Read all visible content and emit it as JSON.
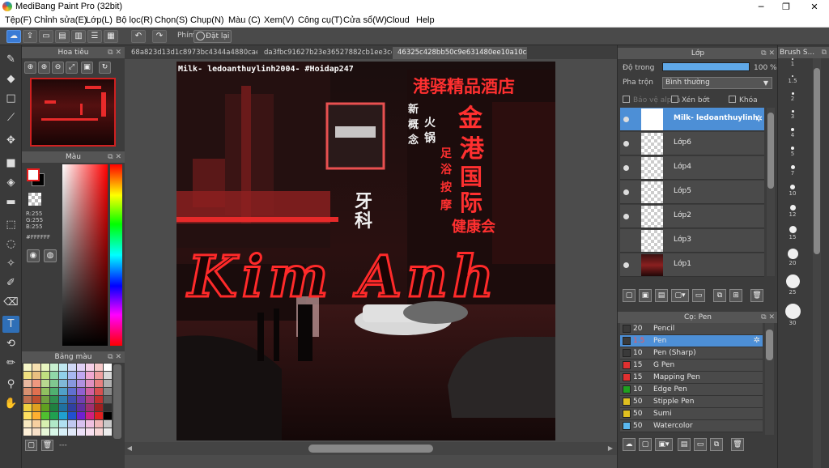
{
  "window": {
    "title": "MediBang Paint Pro (32bit)",
    "minimize": "─",
    "maximize": "❐",
    "close": "✕"
  },
  "menu": [
    "Tệp(F)",
    "Chỉnh sửa(E)",
    "Lớp(L)",
    "Bộ lọc(R)",
    "Chọn(S)",
    "Chụp(N)",
    "Màu (C)",
    "Xem(V)",
    "Công cụ(T)",
    "Cửa sổ(W)",
    "Cloud",
    "Help"
  ],
  "toolbar": {
    "mode_label": "Phím",
    "reset_label": "Đặt lại"
  },
  "navigator": {
    "title": "Hoa tiêu"
  },
  "color": {
    "title": "Màu",
    "r": "R:255",
    "g": "G:255",
    "b": "B:255",
    "hex": "#FFFFFF",
    "fg": "#ffffff",
    "bg": "#000000"
  },
  "palette": {
    "title": "Bảng màu",
    "footer": "---"
  },
  "tabs": [
    "68a823d13d1c8973bc4344a4880cae7d.jpg",
    "da3fbc91627b23e36527882cb1ee3cee.jpg",
    "46325c428bb50c9e631480ee10a10caa.jpg"
  ],
  "canvas": {
    "caption": "Milk- ledoanthuylinh2004- #Hoidap247",
    "signature": "Kim Anh",
    "neon_signs": [
      "港驿精品酒店",
      "金",
      "港",
      "国",
      "际",
      "足",
      "浴",
      "按",
      "摩",
      "健康会",
      "牙",
      "科",
      "新",
      "概",
      "念",
      "火",
      "锅"
    ]
  },
  "layers": {
    "title": "Lớp",
    "opacity_label": "Độ trong",
    "opacity_value": "100 %",
    "opacity": 1.0,
    "blend_label": "Pha trộn",
    "blend_value": "Bình thường",
    "protect_alpha": "Bảo vệ alpha",
    "clip": "Xén bớt",
    "lock": "Khóa",
    "items": [
      {
        "name": "Milk- ledoanthuylinh",
        "selected": true
      },
      {
        "name": "Lớp6",
        "selected": false
      },
      {
        "name": "Lớp4",
        "selected": false
      },
      {
        "name": "Lớp5",
        "selected": false
      },
      {
        "name": "Lớp2",
        "selected": false
      },
      {
        "name": "Lớp3",
        "selected": false
      },
      {
        "name": "Lớp1",
        "selected": false
      }
    ]
  },
  "brushes": {
    "title": "Cọ: Pen",
    "items": [
      {
        "size": "20",
        "name": "Pencil",
        "color": "#3a3a3a"
      },
      {
        "size": "1.5",
        "name": "Pen",
        "color": "#3a3a3a",
        "selected": true
      },
      {
        "size": "10",
        "name": "Pen (Sharp)",
        "color": "#3a3a3a"
      },
      {
        "size": "15",
        "name": "G Pen",
        "color": "#e03030"
      },
      {
        "size": "15",
        "name": "Mapping Pen",
        "color": "#e03030"
      },
      {
        "size": "10",
        "name": "Edge Pen",
        "color": "#20a020"
      },
      {
        "size": "50",
        "name": "Stipple Pen",
        "color": "#e0c020"
      },
      {
        "size": "50",
        "name": "Sumi",
        "color": "#e0c020"
      },
      {
        "size": "50",
        "name": "Watercolor",
        "color": "#5ab8f0"
      }
    ]
  },
  "brush_size": {
    "title": "Brush S...",
    "sizes": [
      "1",
      "1.5",
      "2",
      "3",
      "4",
      "5",
      "7",
      "10",
      "12",
      "15",
      "20",
      "25",
      "30"
    ]
  }
}
